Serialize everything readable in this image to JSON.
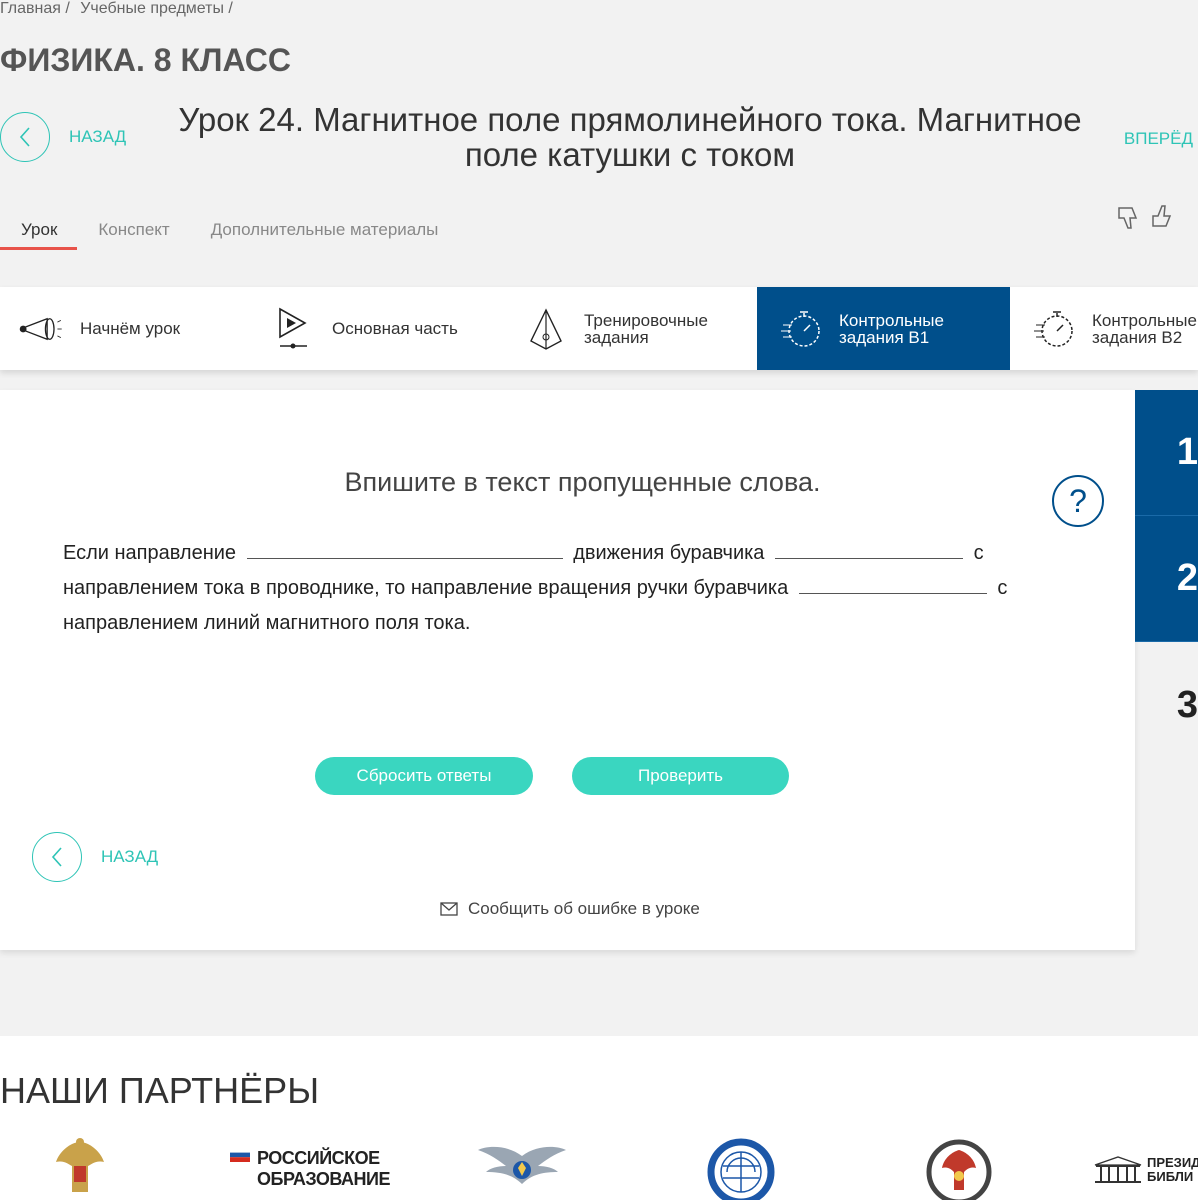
{
  "breadcrumb": {
    "home": "Главная",
    "subjects": "Учебные предметы",
    "sep": "/"
  },
  "course_title": "ФИЗИКА. 8 КЛАСС",
  "nav": {
    "back": "НАЗАД",
    "forward": "ВПЕРЁД"
  },
  "lesson_title": "Урок 24. Магнитное поле прямолинейного тока. Магнитное поле катушки с током",
  "tabs": [
    {
      "label": "Урок",
      "active": true
    },
    {
      "label": "Конспект",
      "active": false
    },
    {
      "label": "Дополнительные материалы",
      "active": false
    }
  ],
  "steps": [
    {
      "icon": "megaphone-icon",
      "line1": "Начнём урок",
      "line2": ""
    },
    {
      "icon": "play-icon",
      "line1": "Основная часть",
      "line2": ""
    },
    {
      "icon": "pyramid-icon",
      "line1": "Тренировочные",
      "line2": "задания"
    },
    {
      "icon": "stopwatch-icon",
      "line1": "Контрольные",
      "line2": "задания В1",
      "active": true
    },
    {
      "icon": "stopwatch-icon",
      "line1": "Контрольные",
      "line2": "задания В2"
    }
  ],
  "side_numbers": [
    "1",
    "2",
    "3"
  ],
  "task": {
    "heading": "Впишите в текст пропущенные слова.",
    "part1": "Если направление",
    "part2": "движения буравчика",
    "part3": "с",
    "part4": "направлением тока в проводнике, то направление вращения ручки буравчика",
    "part5": "с",
    "part6": "направлением линий магнитного поля тока.",
    "help": "?"
  },
  "buttons": {
    "reset": "Сбросить ответы",
    "check": "Проверить"
  },
  "report": "Сообщить об ошибке в уроке",
  "partners": {
    "title": "НАШИ ПАРТНЁРЫ",
    "ros_obr_line1": "РОССИЙСКОЕ",
    "ros_obr_line2": "ОБРАЗОВАНИЕ",
    "library_line1": "ПРЕЗИД",
    "library_line2": "БИБЛИ"
  },
  "colors": {
    "accent": "#2ec4b6",
    "button": "#3ad6c0",
    "active_step": "#004f8b",
    "tab_underline": "#e8534a"
  }
}
